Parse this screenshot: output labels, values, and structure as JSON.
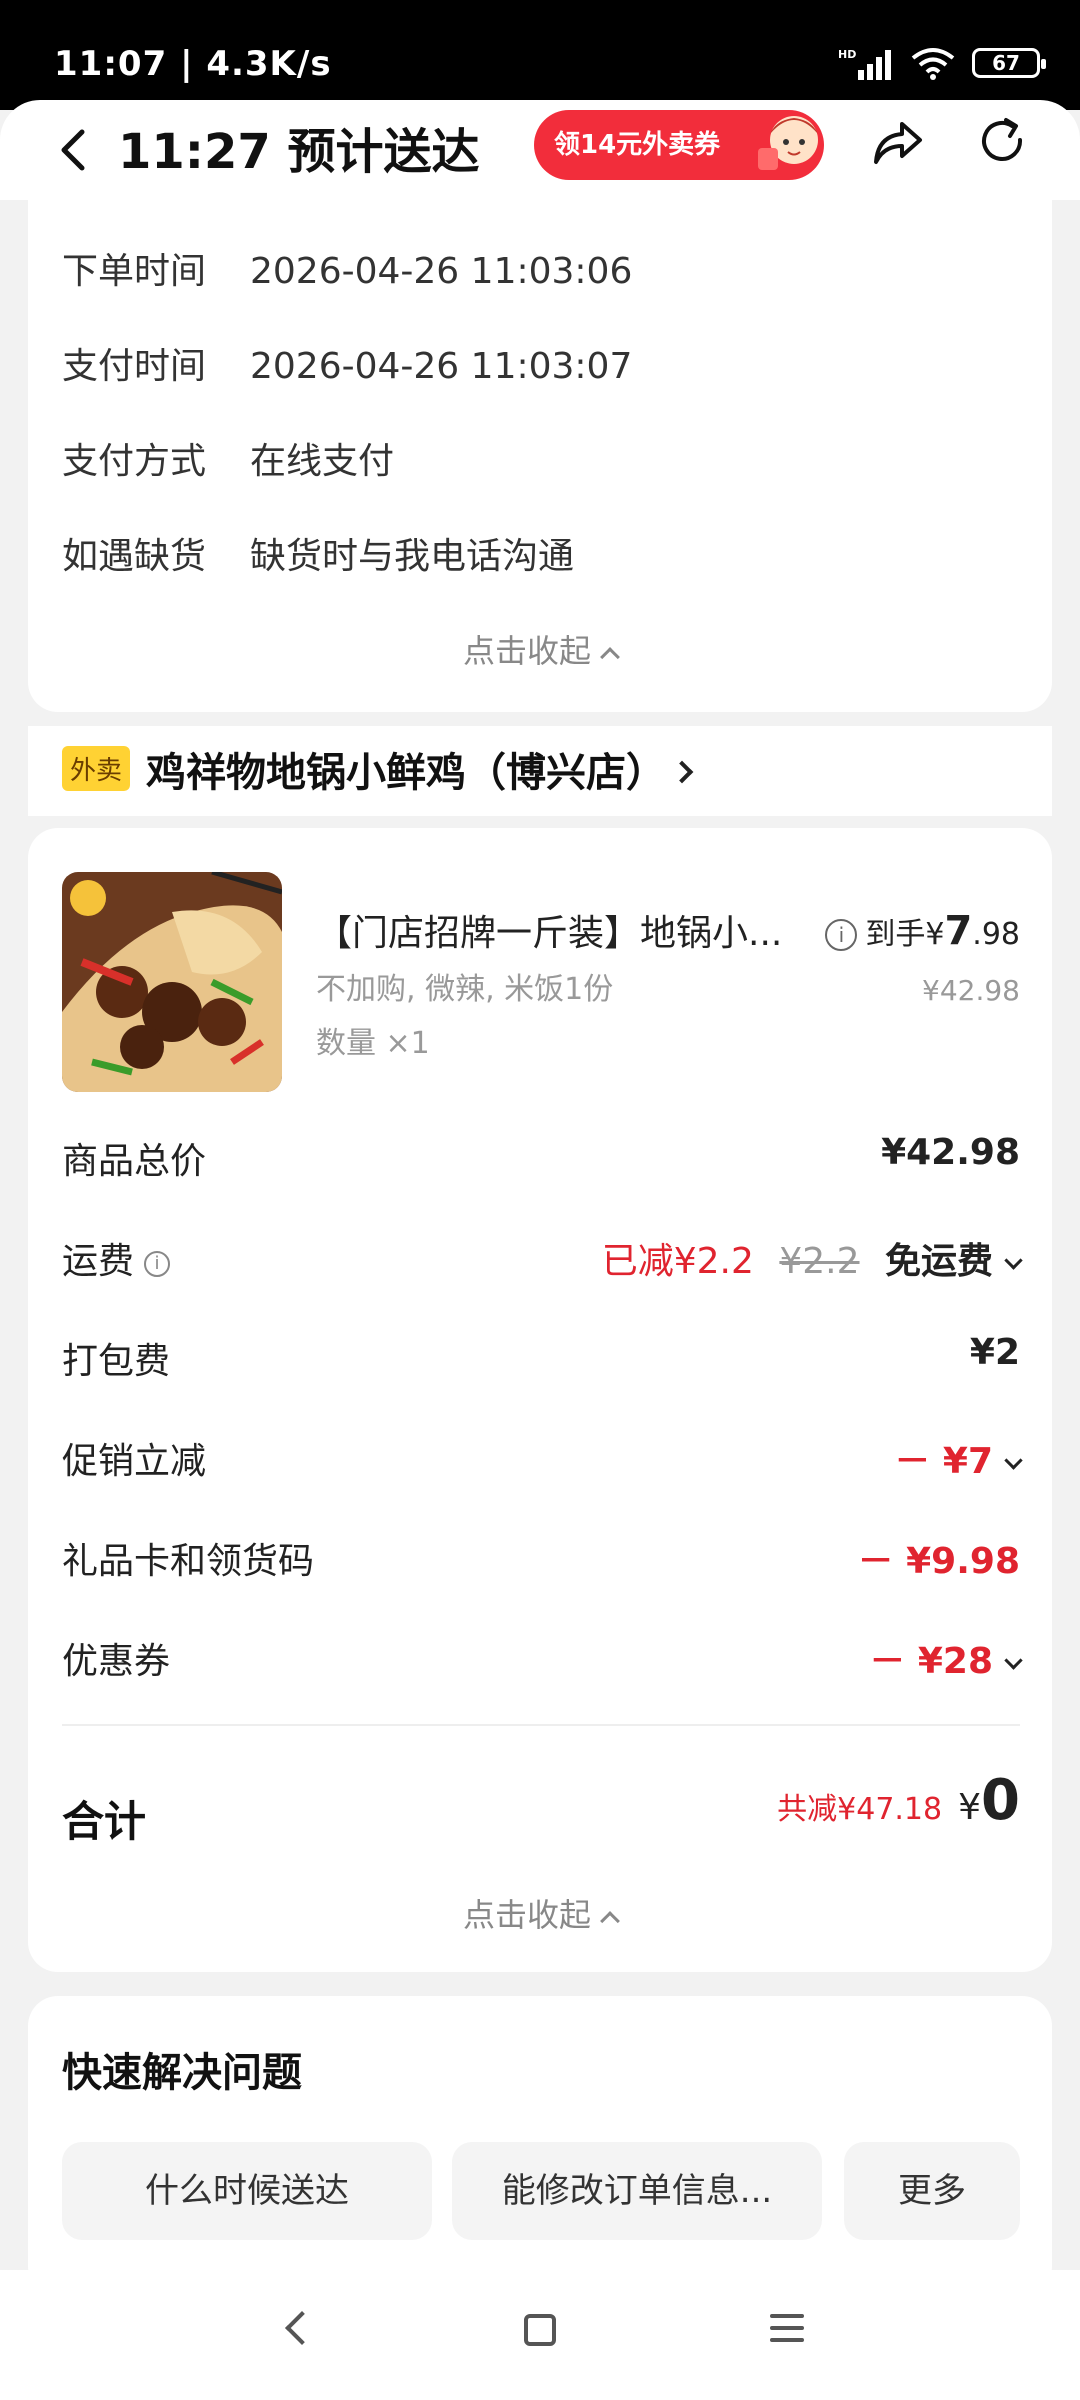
{
  "status_bar": {
    "time": "11:07 | 4.3K/s",
    "battery": "67"
  },
  "header": {
    "title": "11:27 预计送达",
    "promo": "领14元外卖券"
  },
  "order_info": {
    "rows": [
      {
        "label": "下单时间",
        "value": "2026-04-26 11:03:06"
      },
      {
        "label": "支付时间",
        "value": "2026-04-26 11:03:07"
      },
      {
        "label": "支付方式",
        "value": "在线支付"
      },
      {
        "label": "如遇缺货",
        "value": "缺货时与我电话沟通"
      }
    ],
    "collapse_label": "点击收起"
  },
  "store": {
    "tag": "外卖",
    "name": "鸡祥物地锅小鲜鸡（博兴店）"
  },
  "item": {
    "name": "【门店招牌一斤装】地锅小...",
    "spec": "不加购, 微辣, 米饭1份",
    "qty": "数量 ×1",
    "final_prefix": "到手¥",
    "final_int": "7",
    "final_dec": ".98",
    "original": "¥42.98"
  },
  "fees": {
    "subtotal_label": "商品总价",
    "subtotal": "¥42.98",
    "delivery_label": "运费",
    "delivery_saved": "已减¥2.2",
    "delivery_orig": "¥2.2",
    "delivery_free": "免运费",
    "packing_label": "打包费",
    "packing": "¥2",
    "promo_label": "促销立减",
    "promo": "－ ¥7",
    "gift_label": "礼品卡和领货码",
    "gift": "－ ¥9.98",
    "coupon_label": "优惠券",
    "coupon": "－ ¥28"
  },
  "total": {
    "label": "合计",
    "saved": "共减¥47.18",
    "yen": "¥",
    "amount": "0"
  },
  "fees_collapse": "点击收起",
  "quick": {
    "title": "快速解决问题",
    "chips": [
      "什么时候送达",
      "能修改订单信息...",
      "更多"
    ]
  },
  "colors": {
    "accent_red": "#e0242f",
    "promo_red": "#f22d3b",
    "tag_yellow": "#ffd233"
  }
}
